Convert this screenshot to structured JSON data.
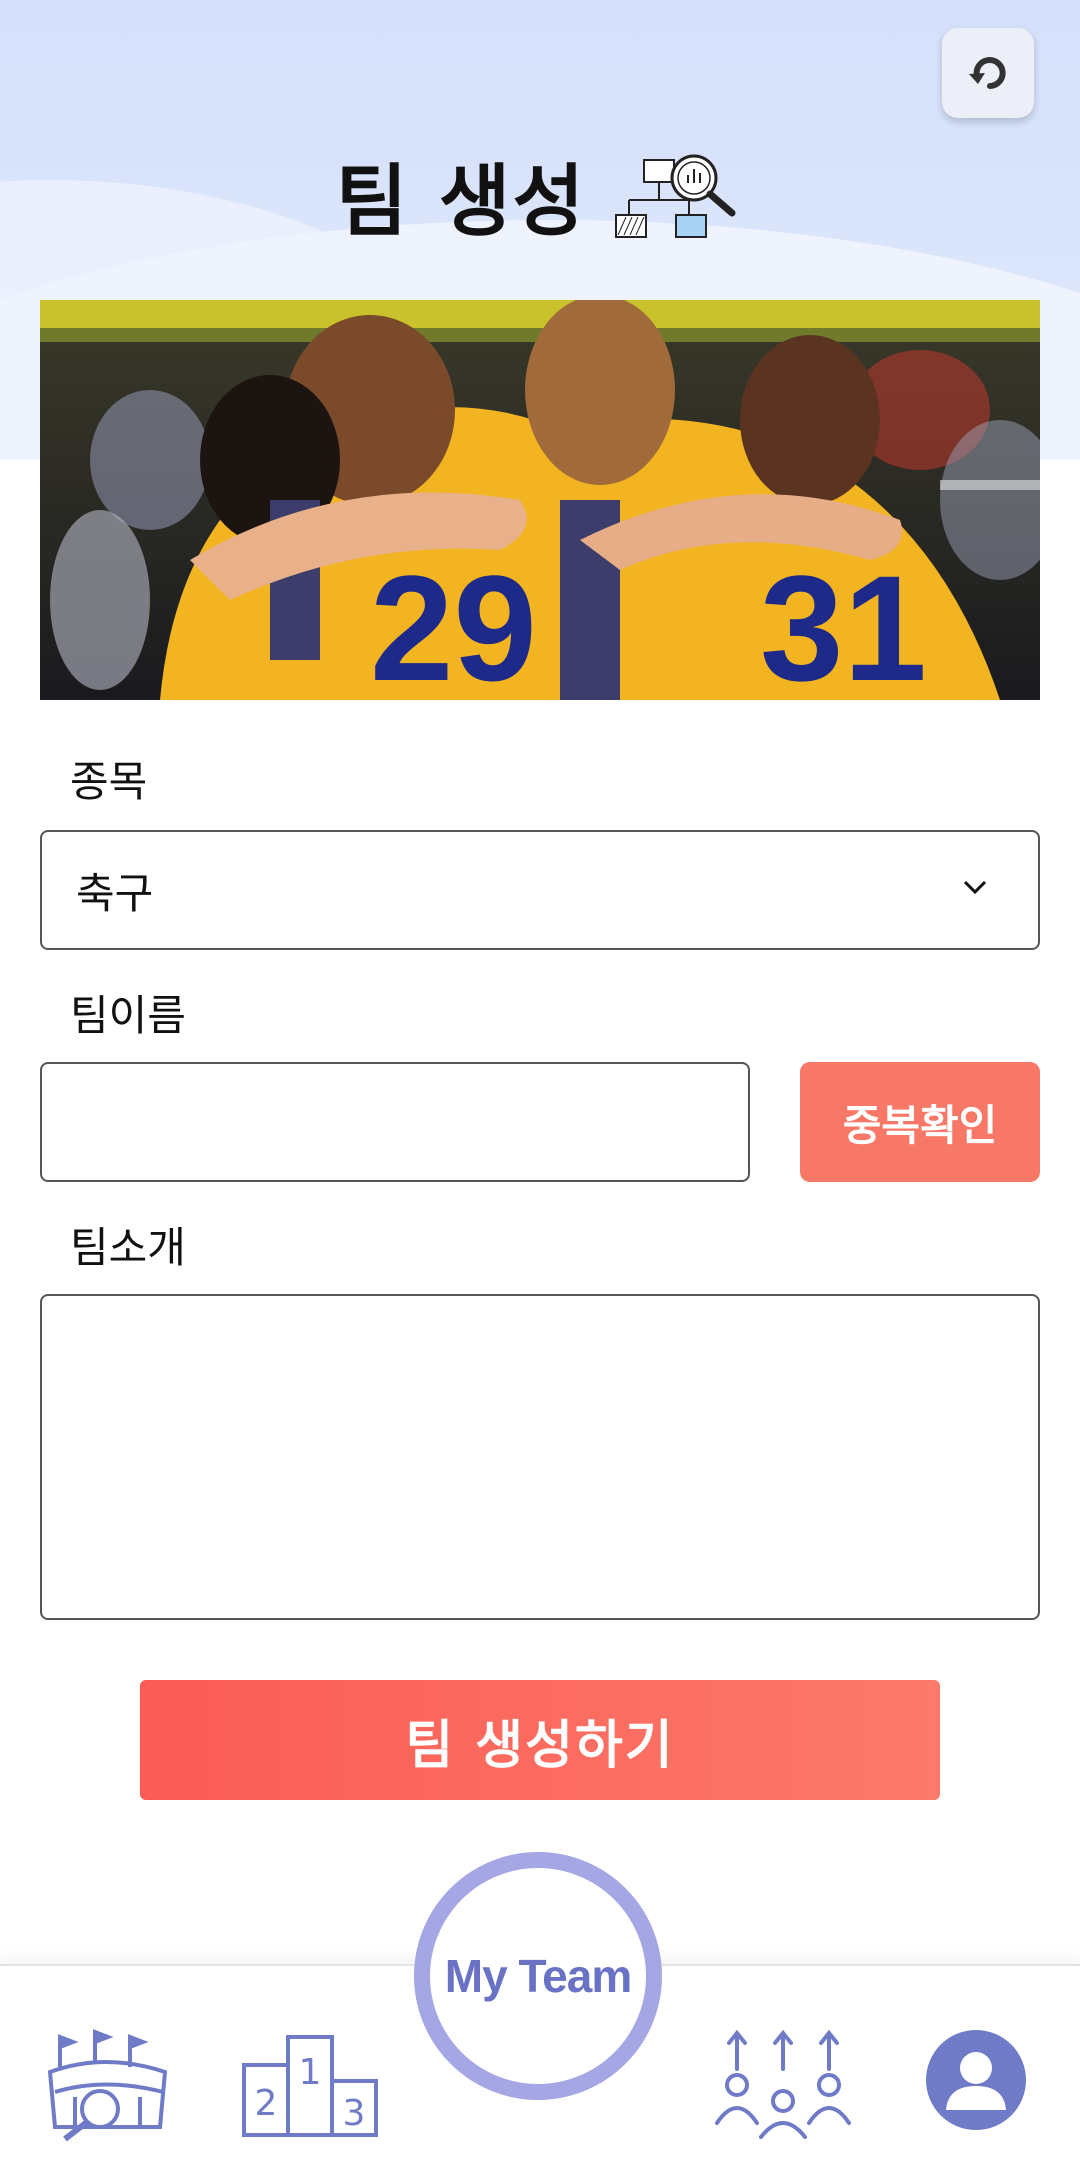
{
  "header": {
    "title": "팀 생성",
    "back_icon": "back-arrow-icon",
    "title_icon": "org-chart-search-icon"
  },
  "hero_image": {
    "description_icon": "team-huddle-photo"
  },
  "form": {
    "sport_label": "종목",
    "sport_value": "축구",
    "team_name_label": "팀이름",
    "team_name_value": "",
    "duplicate_check_label": "중복확인",
    "team_intro_label": "팀소개",
    "team_intro_value": "",
    "submit_label": "팀 생성하기"
  },
  "bottom_nav": {
    "items": [
      {
        "icon": "stadium-search-icon"
      },
      {
        "icon": "podium-icon"
      },
      {
        "label": "My Team"
      },
      {
        "icon": "group-people-icon"
      },
      {
        "icon": "profile-icon"
      }
    ]
  },
  "colors": {
    "accent": "#f87868",
    "nav_accent": "#6a72c6",
    "ring": "#a4a7e3",
    "header_bg": "#d5e0fb"
  }
}
